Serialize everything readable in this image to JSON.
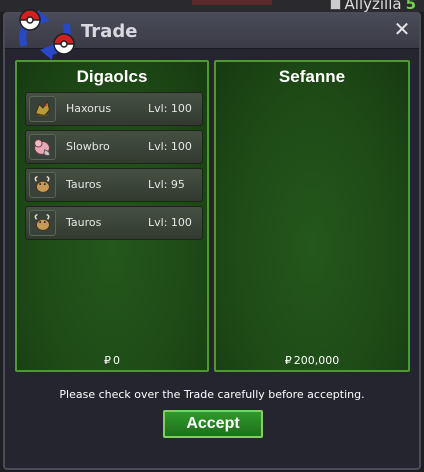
{
  "background": {
    "player_name": "Allyzilla",
    "player_level": "5"
  },
  "window": {
    "title": "Trade",
    "close_glyph": "✕"
  },
  "left_panel": {
    "trainer": "Digaolcs",
    "currency_symbol": "₽",
    "money": "0",
    "pokemon": [
      {
        "name": "Haxorus",
        "level": "Lvl: 100",
        "icon": "haxorus-icon"
      },
      {
        "name": "Slowbro",
        "level": "Lvl: 100",
        "icon": "slowbro-icon"
      },
      {
        "name": "Tauros",
        "level": "Lvl: 95",
        "icon": "tauros-icon"
      },
      {
        "name": "Tauros",
        "level": "Lvl: 100",
        "icon": "tauros-icon"
      }
    ]
  },
  "right_panel": {
    "trainer": "Sefanne",
    "currency_symbol": "₽",
    "money": "200,000",
    "pokemon": []
  },
  "notice": "Please check over the Trade carefully before accepting.",
  "accept_label": "Accept",
  "colors": {
    "panel_green": "#1e4a16",
    "panel_border": "#4e9a31",
    "accept_green": "#2f9a2a",
    "window_bg": "#24252f"
  }
}
